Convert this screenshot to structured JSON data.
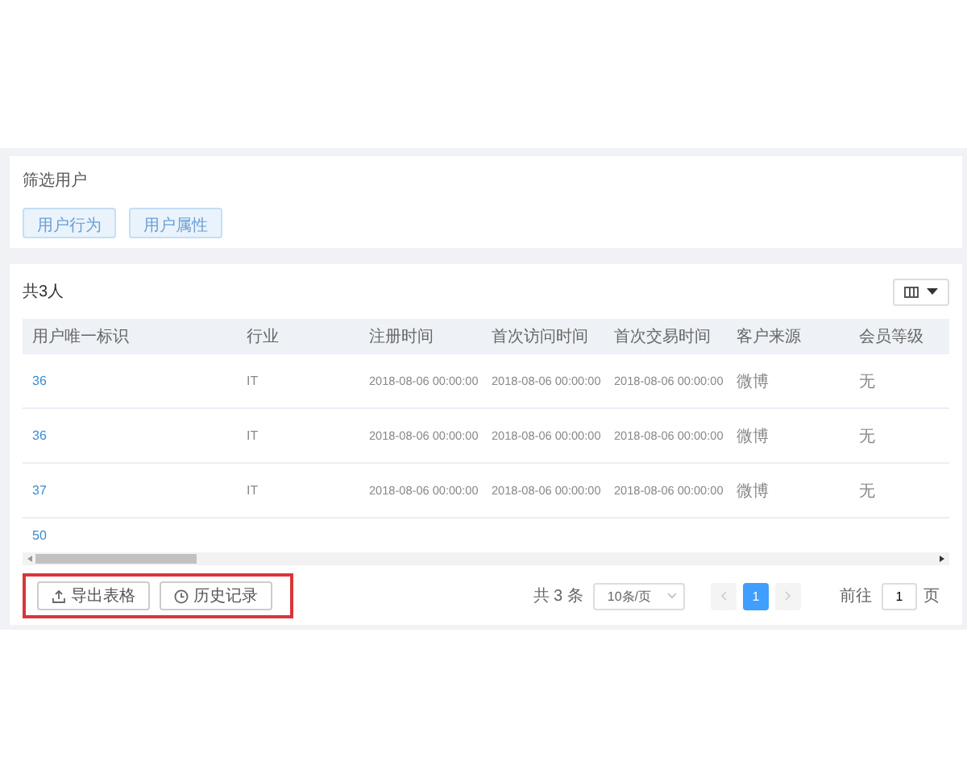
{
  "filter_panel": {
    "title": "筛选用户",
    "buttons": [
      "用户行为",
      "用户属性"
    ]
  },
  "result_panel": {
    "count_label": "共3人",
    "table": {
      "columns": [
        "用户唯一标识",
        "行业",
        "注册时间",
        "首次访问时间",
        "首次交易时间",
        "客户来源",
        "会员等级"
      ],
      "rows": [
        [
          "36",
          "IT",
          "2018-08-06 00:00:00",
          "2018-08-06 00:00:00",
          "2018-08-06 00:00:00",
          "微博",
          "无"
        ],
        [
          "36",
          "IT",
          "2018-08-06 00:00:00",
          "2018-08-06 00:00:00",
          "2018-08-06 00:00:00",
          "微博",
          "无"
        ],
        [
          "37",
          "IT",
          "2018-08-06 00:00:00",
          "2018-08-06 00:00:00",
          "2018-08-06 00:00:00",
          "微博",
          "无"
        ],
        [
          "50"
        ]
      ]
    },
    "actions": {
      "highlighted": true,
      "buttons": [
        {
          "label": "导出表格",
          "kind": "export"
        },
        {
          "label": "历史记录",
          "kind": "history"
        }
      ]
    },
    "pagination": {
      "total": "共 3 条",
      "page_size": "10条/页",
      "pages": [
        {
          "label": "1",
          "selected": true
        }
      ],
      "goto_label": "前往",
      "goto_value": "1",
      "goto_suffix": "页"
    }
  }
}
